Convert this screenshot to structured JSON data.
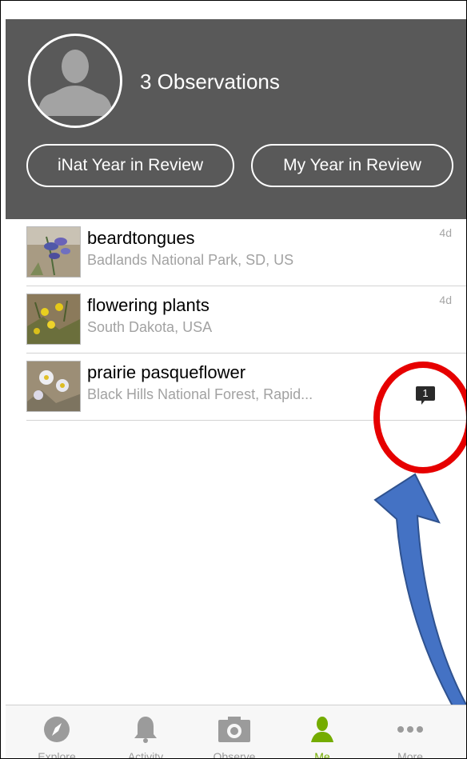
{
  "profile": {
    "observation_count_text": "3 Observations",
    "buttons": [
      "iNat Year in Review",
      "My Year in Review"
    ]
  },
  "observations": [
    {
      "title": "beardtongues",
      "location": "Badlands National Park, SD, US",
      "time": "4d"
    },
    {
      "title": "flowering plants",
      "location": "South Dakota, USA",
      "time": "4d"
    },
    {
      "title": "prairie pasqueflower",
      "location": "Black Hills National Forest, Rapid...",
      "time": "",
      "comment_count": "1"
    }
  ],
  "tabs": [
    {
      "label": "Explore",
      "icon": "compass-icon"
    },
    {
      "label": "Activity",
      "icon": "bell-icon"
    },
    {
      "label": "Observe",
      "icon": "camera-icon"
    },
    {
      "label": "Me",
      "icon": "person-icon",
      "active": true
    },
    {
      "label": "More",
      "icon": "ellipsis-icon"
    }
  ],
  "colors": {
    "header_bg": "#595959",
    "active_tab": "#74ac00",
    "inactive_tab": "#9b9b9b",
    "annotation_circle": "#e60000",
    "annotation_arrow": "#4472c4"
  }
}
